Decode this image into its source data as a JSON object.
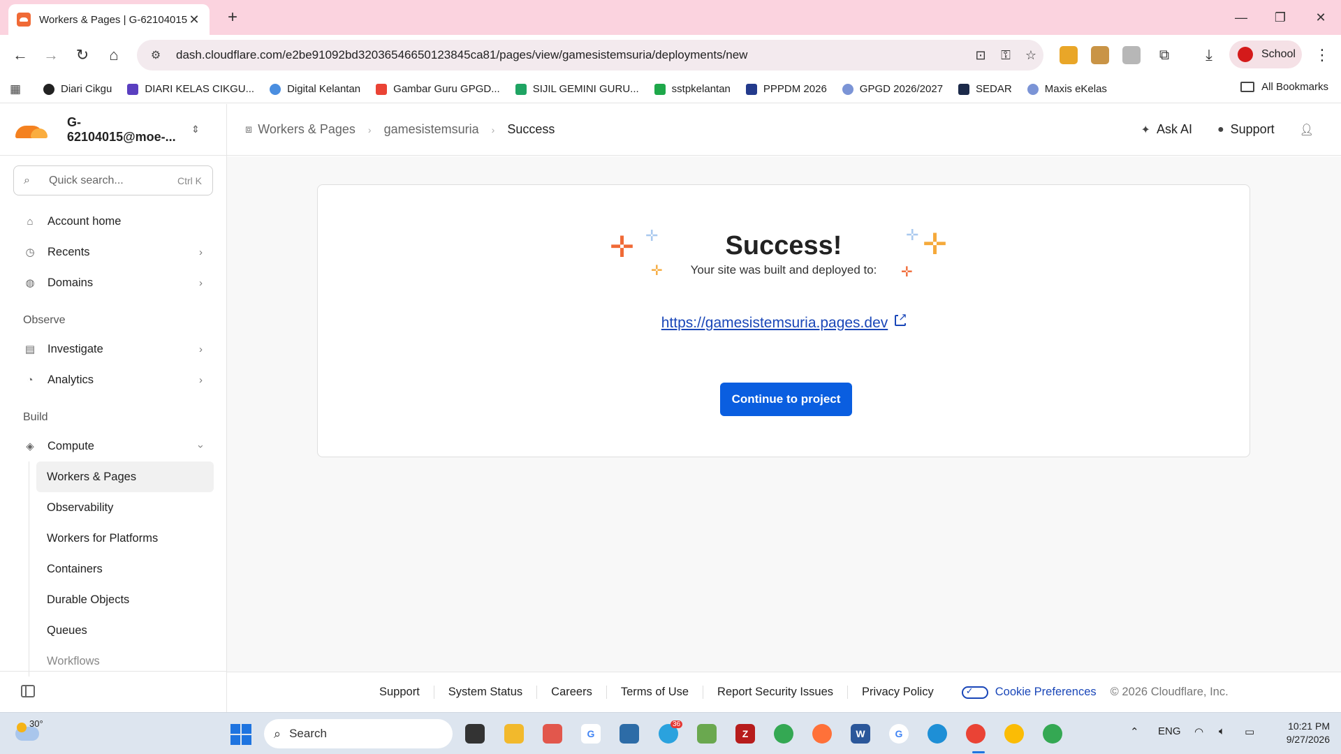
{
  "browser": {
    "tab_title": "Workers & Pages | G-62104015",
    "new_tab": "+",
    "url": "dash.cloudflare.com/e2be91092bd32036546650123845ca81/pages/view/gamesistemsuria/deployments/new",
    "profile": "School",
    "bookmarks": [
      "Diari Cikgu",
      "DIARI KELAS CIKGU...",
      "Digital Kelantan",
      "Gambar Guru GPGD...",
      "SIJIL GEMINI GURU...",
      "sstpkelantan",
      "PPPDM 2026",
      "GPGD 2026/2027",
      "SEDAR",
      "Maxis eKelas"
    ],
    "all_bookmarks": "All Bookmarks"
  },
  "sidebar": {
    "account": "G-62104015@moe-...",
    "search_placeholder": "Quick search...",
    "search_shortcut": "Ctrl K",
    "items": {
      "account_home": "Account home",
      "recents": "Recents",
      "domains": "Domains",
      "section_observe": "Observe",
      "investigate": "Investigate",
      "analytics": "Analytics",
      "section_build": "Build",
      "compute": "Compute"
    },
    "compute_children": [
      "Workers & Pages",
      "Observability",
      "Workers for Platforms",
      "Containers",
      "Durable Objects",
      "Queues",
      "Workflows"
    ]
  },
  "header": {
    "breadcrumb": [
      "Workers & Pages",
      "gamesistemsuria",
      "Success"
    ],
    "ask_ai": "Ask AI",
    "support": "Support"
  },
  "main": {
    "title": "Success!",
    "subtitle": "Your site was built and deployed to:",
    "link": "https://gamesistemsuria.pages.dev",
    "button": "Continue to project"
  },
  "footer": {
    "links": [
      "Support",
      "System Status",
      "Careers",
      "Terms of Use",
      "Report Security Issues",
      "Privacy Policy"
    ],
    "cookie": "Cookie Preferences",
    "copyright": "© 2026 Cloudflare, Inc."
  },
  "taskbar": {
    "temperature": "30°",
    "search": "Search",
    "telegram_badge": "36",
    "lang": "ENG",
    "time": "10:21 PM",
    "date": "9/27/2026"
  },
  "colors": {
    "accent": "#0a5ee0",
    "link": "#1946b8",
    "cloudflare_orange": "#f48120",
    "tabstrip": "#fbd3df"
  }
}
